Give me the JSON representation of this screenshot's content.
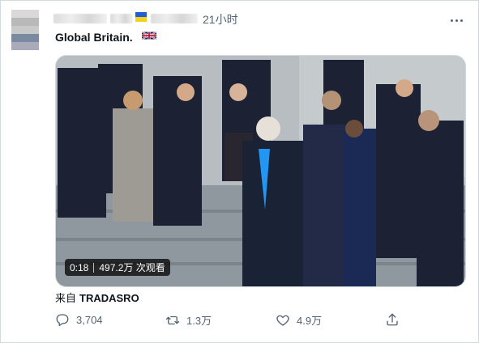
{
  "tweet": {
    "timestamp": "21小时",
    "text": "Global Britain.",
    "flag_emoji_name": "uk-flag",
    "author_flag": "ukraine-flag",
    "source_label": "来自",
    "source_handle": "TRADASRO"
  },
  "video": {
    "duration": "0:18",
    "views": "497.2万 次观看"
  },
  "actions": {
    "reply_count": "3,704",
    "retweet_count": "1.3万",
    "like_count": "4.9万"
  },
  "icons": {
    "reply": "reply-icon",
    "retweet": "retweet-icon",
    "like": "heart-icon",
    "share": "share-icon",
    "more": "more-icon"
  },
  "colors": {
    "muted_text": "#536471",
    "border": "#cfd9de",
    "ua_blue": "#1f5fd6",
    "ua_yellow": "#f6d21c"
  }
}
